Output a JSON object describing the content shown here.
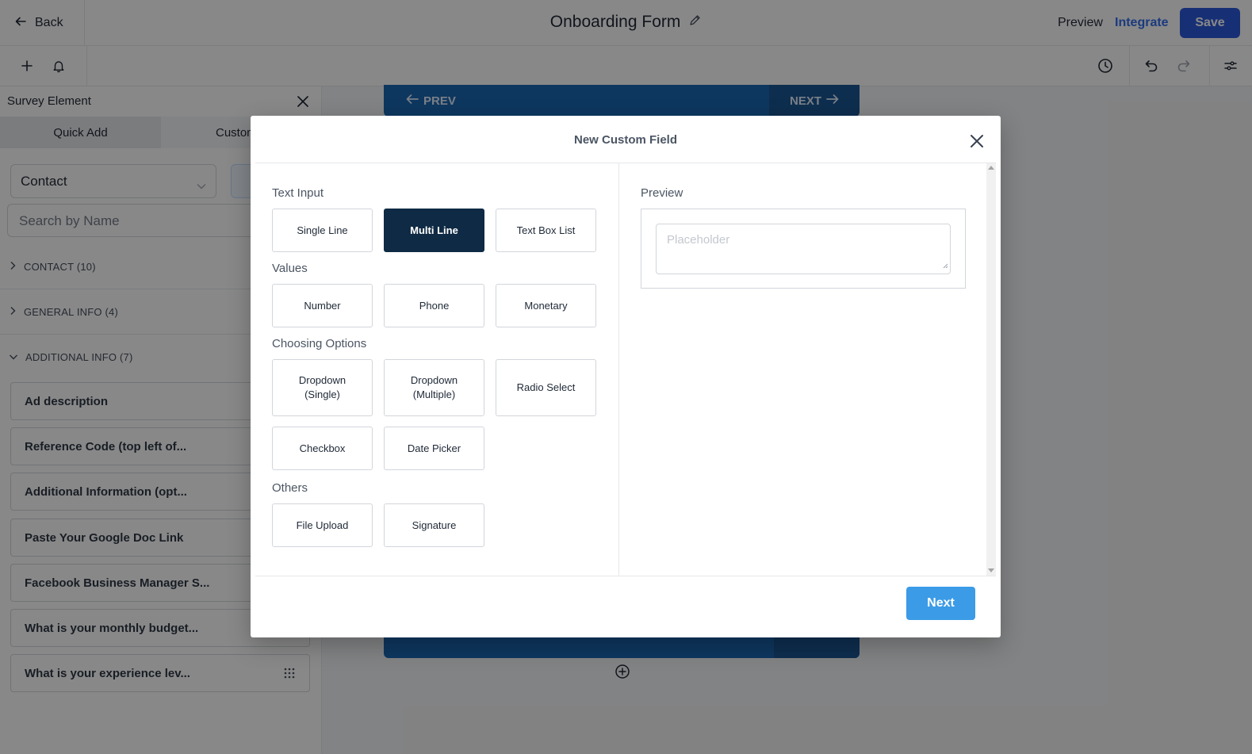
{
  "header": {
    "back_label": "Back",
    "form_title": "Onboarding Form",
    "preview_label": "Preview",
    "integrate_label": "Integrate",
    "save_label": "Save"
  },
  "left_panel": {
    "title": "Survey Element",
    "tabs": [
      "Quick Add",
      "Custom F"
    ],
    "object_select": "Contact",
    "search_placeholder": "Search by Name",
    "groups": [
      {
        "label": "CONTACT (10)",
        "expanded": false
      },
      {
        "label": "GENERAL INFO (4)",
        "expanded": false
      },
      {
        "label": "ADDITIONAL INFO (7)",
        "expanded": true
      }
    ],
    "items": [
      "Ad description",
      "Reference Code (top left of...",
      "Additional Information (opt...",
      "Paste Your Google Doc Link",
      "Facebook Business Manager S...",
      "What is your monthly budget...",
      "What is your experience lev..."
    ]
  },
  "canvas": {
    "prev_label": "PREV",
    "next_label": "NEXT"
  },
  "modal": {
    "title": "New Custom Field",
    "sections": [
      {
        "label": "Text Input",
        "options": [
          "Single Line",
          "Multi Line",
          "Text Box List"
        ]
      },
      {
        "label": "Values",
        "options": [
          "Number",
          "Phone",
          "Monetary"
        ]
      },
      {
        "label": "Choosing Options",
        "options": [
          "Dropdown (Single)",
          "Dropdown (Multiple)",
          "Radio Select",
          "Checkbox",
          "Date Picker"
        ]
      },
      {
        "label": "Others",
        "options": [
          "File Upload",
          "Signature"
        ]
      }
    ],
    "selected_option": "Multi Line",
    "preview_label": "Preview",
    "preview_placeholder": "Placeholder",
    "next_label": "Next"
  },
  "colors": {
    "save_button": "#1d4ed8",
    "integrate_link": "#2563eb",
    "selected_option": "#0f2a44",
    "next_button": "#3b9be6",
    "nav_bar": "#0b5cad"
  }
}
